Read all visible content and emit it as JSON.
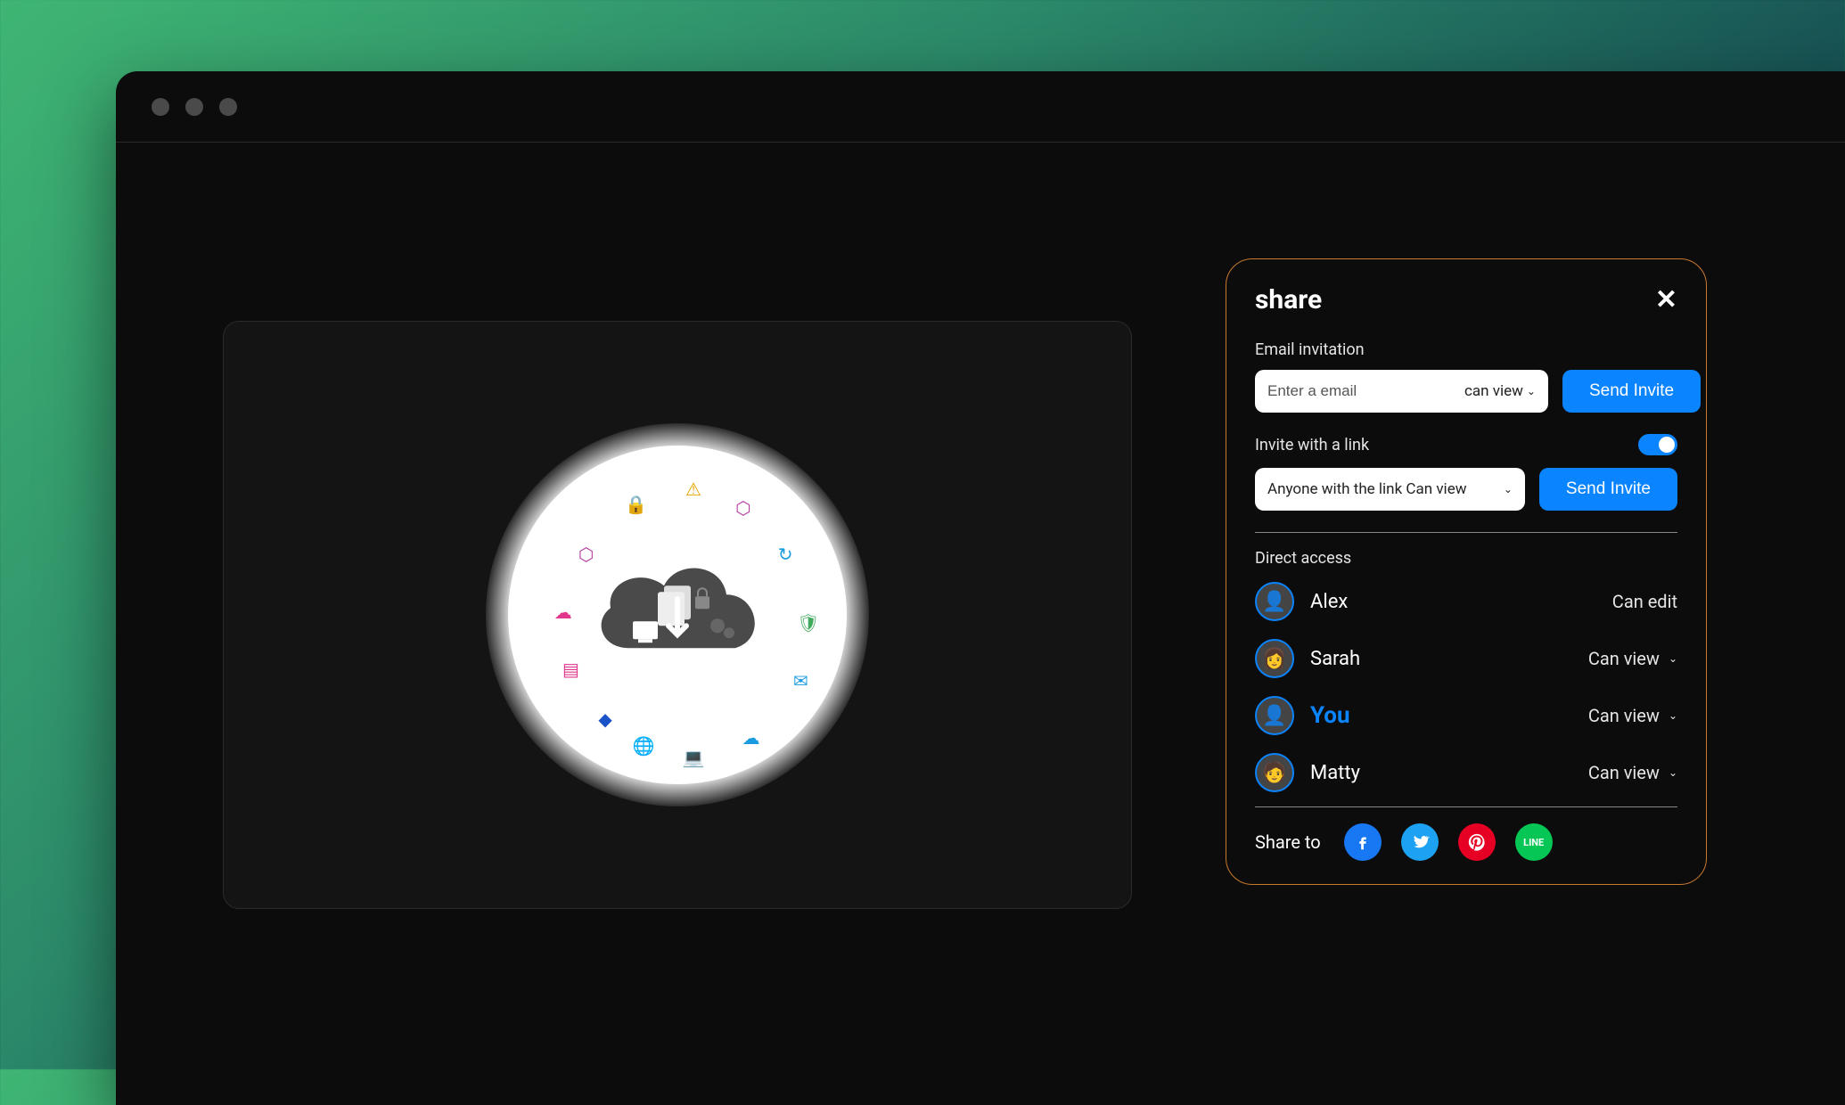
{
  "share": {
    "title": "share",
    "email_section_label": "Email invitation",
    "email_placeholder": "Enter a email",
    "email_permission": "can view",
    "send_invite_label": "Send Invite",
    "link_section_label": "Invite with a link",
    "link_toggle_on": true,
    "link_select_text": "Anyone with the link Can view",
    "direct_access_label": "Direct access",
    "users": [
      {
        "name": "Alex",
        "permission": "Can edit",
        "has_dropdown": false,
        "is_you": false
      },
      {
        "name": "Sarah",
        "permission": "Can view",
        "has_dropdown": true,
        "is_you": false
      },
      {
        "name": "You",
        "permission": "Can view",
        "has_dropdown": true,
        "is_you": true
      },
      {
        "name": "Matty",
        "permission": "Can view",
        "has_dropdown": true,
        "is_you": false
      }
    ],
    "share_to_label": "Share to",
    "social": {
      "facebook": "facebook",
      "twitter": "twitter",
      "pinterest": "pinterest",
      "line": "LINE"
    }
  }
}
